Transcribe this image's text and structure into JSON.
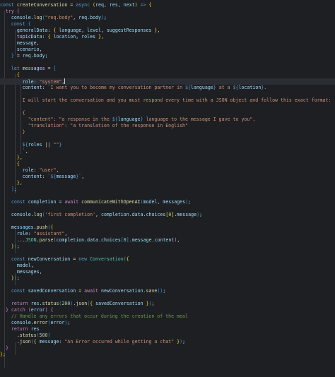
{
  "editor": {
    "language": "javascript",
    "active_line": 12,
    "lines": [
      [
        [
          "kw",
          "const "
        ],
        [
          "fn",
          "createConversation"
        ],
        [
          "pun",
          " = "
        ],
        [
          "kw",
          "async "
        ],
        [
          "br1",
          "("
        ],
        [
          "var",
          "req"
        ],
        [
          "pun",
          ", "
        ],
        [
          "var",
          "res"
        ],
        [
          "pun",
          ", "
        ],
        [
          "var",
          "next"
        ],
        [
          "br1",
          ")"
        ],
        [
          "kw",
          " => "
        ],
        [
          "br1",
          "{"
        ]
      ],
      [
        [
          "pun",
          "  "
        ],
        [
          "ctl",
          "try "
        ],
        [
          "br2",
          "{"
        ]
      ],
      [
        [
          "pun",
          "    "
        ],
        [
          "var",
          "console"
        ],
        [
          "pun",
          "."
        ],
        [
          "fn",
          "log"
        ],
        [
          "br3",
          "("
        ],
        [
          "str",
          "\"req.body\""
        ],
        [
          "pun",
          ", "
        ],
        [
          "var",
          "req"
        ],
        [
          "pun",
          "."
        ],
        [
          "var",
          "body"
        ],
        [
          "br3",
          ")"
        ],
        [
          "pun",
          ";"
        ]
      ],
      [
        [
          "pun",
          "    "
        ],
        [
          "kw",
          "const "
        ],
        [
          "br3",
          "{"
        ]
      ],
      [
        [
          "pun",
          "      "
        ],
        [
          "var",
          "generalData"
        ],
        [
          "pun",
          ": "
        ],
        [
          "br1",
          "{ "
        ],
        [
          "var",
          "language"
        ],
        [
          "pun",
          ", "
        ],
        [
          "var",
          "level"
        ],
        [
          "pun",
          ", "
        ],
        [
          "var",
          "suggestResponses"
        ],
        [
          "br1",
          " }"
        ],
        [
          "pun",
          ","
        ]
      ],
      [
        [
          "pun",
          "      "
        ],
        [
          "var",
          "topicData"
        ],
        [
          "pun",
          ": "
        ],
        [
          "br1",
          "{ "
        ],
        [
          "var",
          "location"
        ],
        [
          "pun",
          ", "
        ],
        [
          "var",
          "roles"
        ],
        [
          "br1",
          " }"
        ],
        [
          "pun",
          ","
        ]
      ],
      [
        [
          "pun",
          "      "
        ],
        [
          "var",
          "message"
        ],
        [
          "pun",
          ","
        ]
      ],
      [
        [
          "pun",
          "      "
        ],
        [
          "var",
          "scenario"
        ],
        [
          "pun",
          ","
        ]
      ],
      [
        [
          "pun",
          "    "
        ],
        [
          "br3",
          "}"
        ],
        [
          "pun",
          " = "
        ],
        [
          "var",
          "req"
        ],
        [
          "pun",
          "."
        ],
        [
          "var",
          "body"
        ],
        [
          "pun",
          ";"
        ]
      ],
      [
        [
          "pun",
          ""
        ]
      ],
      [
        [
          "pun",
          "    "
        ],
        [
          "kw",
          "let "
        ],
        [
          "var",
          "messages"
        ],
        [
          "pun",
          " = "
        ],
        [
          "br3",
          "["
        ]
      ],
      [
        [
          "pun",
          "      "
        ],
        [
          "br1",
          "{"
        ]
      ],
      [
        [
          "pun",
          "        "
        ],
        [
          "var",
          "role"
        ],
        [
          "pun",
          ": "
        ],
        [
          "str",
          "\"system\""
        ],
        [
          "pun",
          ","
        ],
        [
          "cursor",
          ""
        ]
      ],
      [
        [
          "pun",
          "        "
        ],
        [
          "var",
          "content"
        ],
        [
          "pun",
          ": "
        ],
        [
          "tpl",
          "`I want you to become my conversation partner in "
        ],
        [
          "kw",
          "${"
        ],
        [
          "var",
          "language"
        ],
        [
          "kw",
          "}"
        ],
        [
          "tpl",
          " at a "
        ],
        [
          "kw",
          "${"
        ],
        [
          "var",
          "location"
        ],
        [
          "kw",
          "}"
        ],
        [
          "tpl",
          "."
        ]
      ],
      [
        [
          "pun",
          ""
        ]
      ],
      [
        [
          "tpl",
          "        I will start the conversation and you must respond every time with a JSON object and follow this exact format:"
        ]
      ],
      [
        [
          "pun",
          ""
        ]
      ],
      [
        [
          "tpl",
          "        {"
        ]
      ],
      [
        [
          "tpl",
          "          \"content\": \"a response in the "
        ],
        [
          "kw",
          "${"
        ],
        [
          "var",
          "language"
        ],
        [
          "kw",
          "}"
        ],
        [
          "tpl",
          " language to the message I gave to you\","
        ]
      ],
      [
        [
          "tpl",
          "          \"translation\": \"a translation of the response in English\""
        ]
      ],
      [
        [
          "tpl",
          "        }"
        ]
      ],
      [
        [
          "pun",
          ""
        ]
      ],
      [
        [
          "pun",
          "        "
        ],
        [
          "kw",
          "${"
        ],
        [
          "var",
          "roles"
        ],
        [
          "pun",
          " || "
        ],
        [
          "str",
          "\"\""
        ],
        [
          "kw",
          "}"
        ]
      ],
      [
        [
          "tpl",
          "        `"
        ],
        [
          "pun",
          ","
        ]
      ],
      [
        [
          "pun",
          "      "
        ],
        [
          "br1",
          "}"
        ],
        [
          "pun",
          ","
        ]
      ],
      [
        [
          "pun",
          "      "
        ],
        [
          "br1",
          "{"
        ]
      ],
      [
        [
          "pun",
          "        "
        ],
        [
          "var",
          "role"
        ],
        [
          "pun",
          ": "
        ],
        [
          "str",
          "\"user\""
        ],
        [
          "pun",
          ","
        ]
      ],
      [
        [
          "pun",
          "        "
        ],
        [
          "var",
          "content"
        ],
        [
          "pun",
          ": "
        ],
        [
          "tpl",
          "`"
        ],
        [
          "kw",
          "${"
        ],
        [
          "var",
          "message"
        ],
        [
          "kw",
          "}"
        ],
        [
          "tpl",
          "`"
        ],
        [
          "pun",
          ","
        ]
      ],
      [
        [
          "pun",
          "      "
        ],
        [
          "br1",
          "}"
        ],
        [
          "pun",
          ","
        ]
      ],
      [
        [
          "pun",
          "    "
        ],
        [
          "br3",
          "]"
        ],
        [
          "pun",
          ";"
        ]
      ],
      [
        [
          "pun",
          ""
        ]
      ],
      [
        [
          "pun",
          "    "
        ],
        [
          "kw",
          "const "
        ],
        [
          "var",
          "completion"
        ],
        [
          "pun",
          " = "
        ],
        [
          "ctl",
          "await "
        ],
        [
          "fn",
          "communicateWithOpenAI"
        ],
        [
          "br3",
          "("
        ],
        [
          "var",
          "model"
        ],
        [
          "pun",
          ", "
        ],
        [
          "var",
          "messages"
        ],
        [
          "br3",
          ")"
        ],
        [
          "pun",
          ";"
        ]
      ],
      [
        [
          "pun",
          ""
        ]
      ],
      [
        [
          "pun",
          "    "
        ],
        [
          "var",
          "console"
        ],
        [
          "pun",
          "."
        ],
        [
          "fn",
          "log"
        ],
        [
          "br3",
          "("
        ],
        [
          "tpl",
          "'first completion'"
        ],
        [
          "pun",
          ", "
        ],
        [
          "var",
          "completion"
        ],
        [
          "pun",
          "."
        ],
        [
          "var",
          "data"
        ],
        [
          "pun",
          "."
        ],
        [
          "var",
          "choices"
        ],
        [
          "br1",
          "["
        ],
        [
          "num",
          "0"
        ],
        [
          "br1",
          "]"
        ],
        [
          "pun",
          "."
        ],
        [
          "var",
          "message"
        ],
        [
          "br3",
          ")"
        ],
        [
          "pun",
          ";"
        ]
      ],
      [
        [
          "pun",
          ""
        ]
      ],
      [
        [
          "pun",
          "    "
        ],
        [
          "var",
          "messages"
        ],
        [
          "pun",
          "."
        ],
        [
          "fn",
          "push"
        ],
        [
          "br3",
          "("
        ],
        [
          "br1",
          "{"
        ]
      ],
      [
        [
          "pun",
          "      "
        ],
        [
          "var",
          "role"
        ],
        [
          "pun",
          ": "
        ],
        [
          "str",
          "\"assistant\""
        ],
        [
          "pun",
          ","
        ]
      ],
      [
        [
          "pun",
          "      ..."
        ],
        [
          "cls",
          "JSON"
        ],
        [
          "pun",
          "."
        ],
        [
          "fn",
          "parse"
        ],
        [
          "br2",
          "("
        ],
        [
          "var",
          "completion"
        ],
        [
          "pun",
          "."
        ],
        [
          "var",
          "data"
        ],
        [
          "pun",
          "."
        ],
        [
          "var",
          "choices"
        ],
        [
          "br3",
          "["
        ],
        [
          "num",
          "0"
        ],
        [
          "br3",
          "]"
        ],
        [
          "pun",
          "."
        ],
        [
          "var",
          "message"
        ],
        [
          "pun",
          "."
        ],
        [
          "var",
          "content"
        ],
        [
          "br2",
          ")"
        ],
        [
          "pun",
          ","
        ]
      ],
      [
        [
          "pun",
          "    "
        ],
        [
          "br1",
          "}"
        ],
        [
          "br3",
          ")"
        ],
        [
          "pun",
          ";"
        ]
      ],
      [
        [
          "pun",
          ""
        ]
      ],
      [
        [
          "pun",
          "    "
        ],
        [
          "kw",
          "const "
        ],
        [
          "var",
          "newConversation"
        ],
        [
          "pun",
          " = "
        ],
        [
          "kw",
          "new "
        ],
        [
          "cls",
          "Conversation"
        ],
        [
          "br3",
          "("
        ],
        [
          "br1",
          "{"
        ]
      ],
      [
        [
          "pun",
          "      "
        ],
        [
          "var",
          "model"
        ],
        [
          "pun",
          ","
        ]
      ],
      [
        [
          "pun",
          "      "
        ],
        [
          "var",
          "messages"
        ],
        [
          "pun",
          ","
        ]
      ],
      [
        [
          "pun",
          "    "
        ],
        [
          "br1",
          "}"
        ],
        [
          "br3",
          ")"
        ],
        [
          "pun",
          ";"
        ]
      ],
      [
        [
          "pun",
          ""
        ]
      ],
      [
        [
          "pun",
          "    "
        ],
        [
          "kw",
          "const "
        ],
        [
          "var",
          "savedConversation"
        ],
        [
          "pun",
          " = "
        ],
        [
          "ctl",
          "await "
        ],
        [
          "var",
          "newConversation"
        ],
        [
          "pun",
          "."
        ],
        [
          "fn",
          "save"
        ],
        [
          "br3",
          "()"
        ],
        [
          "pun",
          ";"
        ]
      ],
      [
        [
          "pun",
          ""
        ]
      ],
      [
        [
          "pun",
          "    "
        ],
        [
          "ctl",
          "return "
        ],
        [
          "var",
          "res"
        ],
        [
          "pun",
          "."
        ],
        [
          "fn",
          "status"
        ],
        [
          "br3",
          "("
        ],
        [
          "num",
          "200"
        ],
        [
          "br3",
          ")"
        ],
        [
          "pun",
          "."
        ],
        [
          "fn",
          "json"
        ],
        [
          "br3",
          "("
        ],
        [
          "br1",
          "{ "
        ],
        [
          "var",
          "savedConversation"
        ],
        [
          "br1",
          " }"
        ],
        [
          "br3",
          ")"
        ],
        [
          "pun",
          ";"
        ]
      ],
      [
        [
          "pun",
          "  "
        ],
        [
          "br2",
          "}"
        ],
        [
          "ctl",
          " catch "
        ],
        [
          "br2",
          "("
        ],
        [
          "var",
          "error"
        ],
        [
          "br2",
          ")"
        ],
        [
          "pun",
          " "
        ],
        [
          "br2",
          "{"
        ]
      ],
      [
        [
          "cmt",
          "    // Handle any errors that occur during the creation of the meal"
        ]
      ],
      [
        [
          "pun",
          "    "
        ],
        [
          "var",
          "console"
        ],
        [
          "pun",
          "."
        ],
        [
          "fn",
          "error"
        ],
        [
          "br3",
          "("
        ],
        [
          "var",
          "error"
        ],
        [
          "br3",
          ")"
        ],
        [
          "pun",
          ";"
        ]
      ],
      [
        [
          "pun",
          "    "
        ],
        [
          "ctl",
          "return "
        ],
        [
          "var",
          "res"
        ]
      ],
      [
        [
          "pun",
          "      ."
        ],
        [
          "fn",
          "status"
        ],
        [
          "br3",
          "("
        ],
        [
          "num",
          "500"
        ],
        [
          "br3",
          ")"
        ]
      ],
      [
        [
          "pun",
          "      ."
        ],
        [
          "fn",
          "json"
        ],
        [
          "br3",
          "("
        ],
        [
          "br1",
          "{ "
        ],
        [
          "var",
          "message"
        ],
        [
          "pun",
          ": "
        ],
        [
          "str",
          "\"An Error occured while getting a chat\""
        ],
        [
          "br1",
          " }"
        ],
        [
          "br3",
          ")"
        ],
        [
          "pun",
          ";"
        ]
      ],
      [
        [
          "pun",
          "  "
        ],
        [
          "br2",
          "}"
        ]
      ],
      [
        [
          "br1",
          "}"
        ],
        [
          "pun",
          ";"
        ]
      ]
    ]
  }
}
